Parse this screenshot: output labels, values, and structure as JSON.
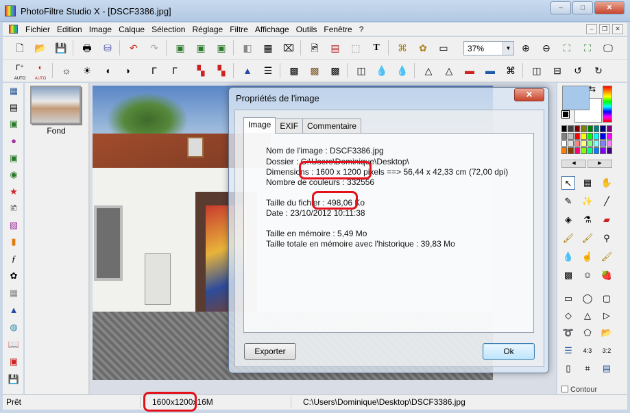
{
  "window": {
    "title": "PhotoFiltre Studio X - [DSCF3386.jpg]",
    "buttons": [
      "–",
      "□",
      "✕"
    ]
  },
  "menu": {
    "items": [
      "Fichier",
      "Edition",
      "Image",
      "Calque",
      "Sélection",
      "Réglage",
      "Filtre",
      "Affichage",
      "Outils",
      "Fenêtre",
      "?"
    ],
    "mdi_buttons": [
      "–",
      "❐",
      "✕"
    ]
  },
  "toolbar": {
    "zoom_value": "37%"
  },
  "toolbar2": {
    "auto_label_1": "AUTO",
    "auto_label_2": "AUTO"
  },
  "layers": {
    "layer_name": "Fond"
  },
  "dialog": {
    "title": "Propriétés de l'image",
    "close_label": "✕",
    "tabs": [
      "Image",
      "EXIF",
      "Commentaire"
    ],
    "active_tab": "Image",
    "lines": [
      "Nom de l'image : DSCF3386.jpg",
      "Dossier : C:\\Users\\Dominique\\Desktop\\",
      "Dimensions : 1600 x 1200 pixels ==> 56,44 x 42,33 cm  (72,00 dpi)",
      "Nombre de couleurs : 332556",
      "Taille du fichier : 498,06 Ko",
      "Date : 23/10/2012 10:11:38",
      "Taille en mémoire : 5,49 Mo",
      "Taille totale en mémoire avec l'historique : 39,83 Mo"
    ],
    "export_button": "Exporter",
    "ok_button": "Ok"
  },
  "right_panel": {
    "contour_label": "Contour"
  },
  "status": {
    "ready": "Prêt",
    "dimensions": "1600x1200x16M",
    "path": "C:\\Users\\Dominique\\Desktop\\DSCF3386.jpg"
  },
  "colors": {
    "highlight_ring": "#e3111b",
    "foreground_color": "#a6c8ea",
    "background_color": "#ffffff"
  },
  "palette": [
    "#000000",
    "#404040",
    "#800000",
    "#808000",
    "#008000",
    "#008080",
    "#000080",
    "#800080",
    "#808080",
    "#c0c0c0",
    "#ff0000",
    "#ffff00",
    "#00ff00",
    "#00ffff",
    "#0000ff",
    "#ff00ff",
    "#ffffff",
    "#e0e0e0",
    "#ff8080",
    "#ffff80",
    "#80ff80",
    "#80ffff",
    "#8080ff",
    "#ff80ff",
    "#ff8000",
    "#804000",
    "#ff0080",
    "#80ff00",
    "#00ff80",
    "#0080ff",
    "#8000ff",
    "#400080"
  ]
}
